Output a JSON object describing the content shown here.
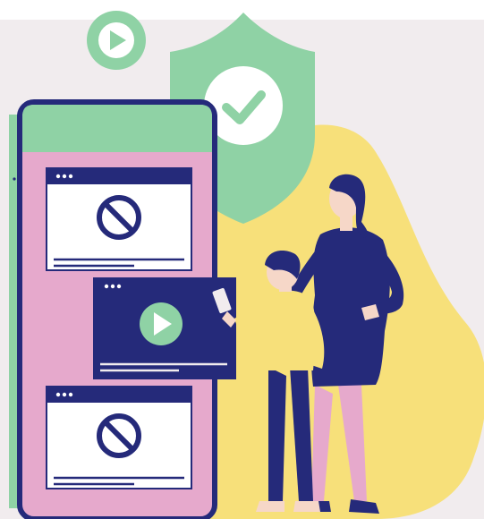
{
  "colors": {
    "background": "#f1ecee",
    "green": "#8fd2a5",
    "green_dark": "#6cc088",
    "navy": "#252a7a",
    "pink": "#e6a9cc",
    "yellow": "#f7e07a",
    "skin": "#f6d7c8",
    "white": "#ffffff"
  },
  "illustration": {
    "theme": "parental-control-video-blocking",
    "icons": [
      "play-badge-icon",
      "shield-check-icon",
      "blocked-icon",
      "play-icon"
    ],
    "phone": {
      "panels": [
        {
          "state": "blocked",
          "icon": "blocked-icon"
        },
        {
          "state": "allowed",
          "icon": "play-icon"
        },
        {
          "state": "blocked",
          "icon": "blocked-icon"
        }
      ]
    },
    "figures": [
      "parent",
      "child"
    ]
  }
}
